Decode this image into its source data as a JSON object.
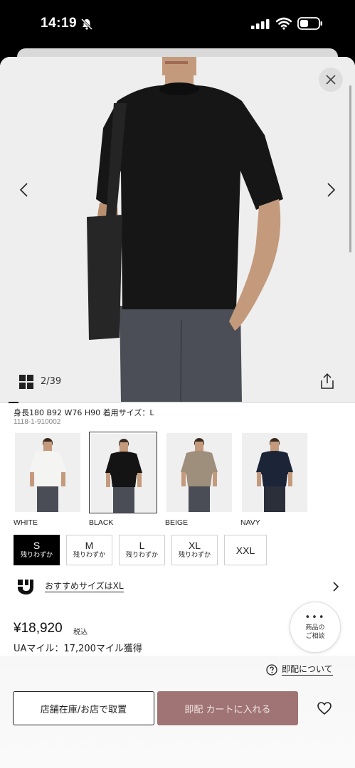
{
  "status_bar": {
    "time": "14:19"
  },
  "gallery": {
    "counter": "2/39"
  },
  "product": {
    "model_info": "身長180 B92 W76 H90 着用サイズ：L",
    "code": "1118-1-910002",
    "price": "¥18,920",
    "tax_label": "税込",
    "miles": "UAマイル：17,200マイル獲得"
  },
  "colors": [
    {
      "label": "WHITE",
      "shirt": "#f4f4f2",
      "pants": "#4a4d55"
    },
    {
      "label": "BLACK",
      "shirt": "#141414",
      "pants": "#4a4d55",
      "selected": true
    },
    {
      "label": "BEIGE",
      "shirt": "#9e8e7c",
      "pants": "#4a4d55"
    },
    {
      "label": "NAVY",
      "shirt": "#1c2538",
      "pants": "#2a2f3a"
    }
  ],
  "sizes": [
    {
      "name": "S",
      "stock": "残りわずか",
      "selected": true
    },
    {
      "name": "M",
      "stock": "残りわずか"
    },
    {
      "name": "L",
      "stock": "残りわずか"
    },
    {
      "name": "XL",
      "stock": "残りわずか"
    },
    {
      "name": "XXL",
      "stock": ""
    }
  ],
  "recommend": {
    "text": "おすすめサイズはXL"
  },
  "consult": {
    "label": "商品の\nご相談"
  },
  "help": {
    "text": "即配について"
  },
  "actions": {
    "store_label": "店舗在庫/お店で取置",
    "cart_label": "即配 カートに入れる"
  },
  "theme": {
    "cart_color": "#a07474"
  }
}
